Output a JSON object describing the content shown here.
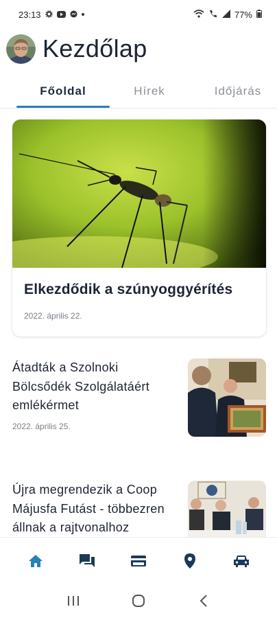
{
  "status_bar": {
    "time": "23:13",
    "battery": "77%",
    "icons": [
      "settings-icon",
      "youtube-icon",
      "messenger-icon",
      "wifi-icon",
      "wifi-call-icon",
      "signal-icon",
      "battery-icon"
    ]
  },
  "header": {
    "title": "Kezdőlap",
    "avatar": "user-avatar"
  },
  "tabs": [
    {
      "label": "Főoldal",
      "active": true
    },
    {
      "label": "Hírek",
      "active": false
    },
    {
      "label": "Időjárás",
      "active": false
    }
  ],
  "featured": {
    "title": "Elkezdődik a szúnyoggyérítés",
    "date": "2022. április 22.",
    "image": "mosquito-photo"
  },
  "news": [
    {
      "title_lines": [
        "Átadták a Szolnoki",
        "Bölcsődék Szolgálatáért",
        "emlékérmet"
      ],
      "date": "2022. április 25.",
      "image": "award-ceremony-photo"
    },
    {
      "title_lines": [
        "Újra megrendezik a Coop",
        "Májusfa Futást - többezren",
        "állnak a rajtvonalhoz"
      ],
      "image": "meeting-photo"
    }
  ],
  "bottom_nav": [
    {
      "icon": "home-icon",
      "active": true
    },
    {
      "icon": "chat-icon",
      "active": false
    },
    {
      "icon": "card-icon",
      "active": false
    },
    {
      "icon": "location-pin-icon",
      "active": false
    },
    {
      "icon": "car-icon",
      "active": false
    }
  ],
  "colors": {
    "accent": "#2a80b9",
    "nav_icon": "#1c3a57",
    "title": "#1d2433",
    "muted": "#7a7f86"
  }
}
